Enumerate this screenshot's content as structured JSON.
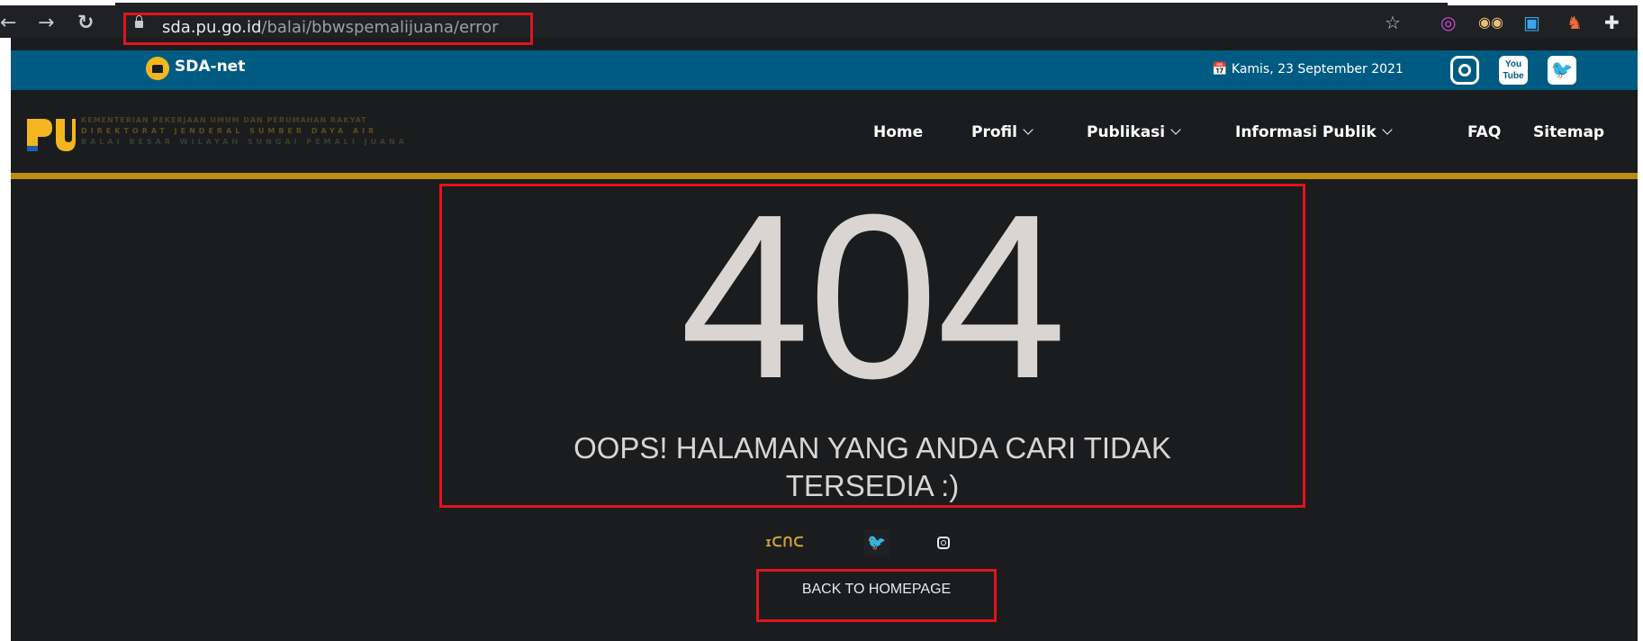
{
  "browser": {
    "url_host": "sda.pu.go.id",
    "url_path": "/balai/bbwspemalijuana/error",
    "back_icon": "back-arrow-icon",
    "forward_icon": "forward-arrow-icon",
    "reload_icon": "reload-icon",
    "bookmark_icon": "star-icon",
    "extension_icons": [
      "opera-icon",
      "spy-icon",
      "translate-icon",
      "person-icon",
      "puzzle-icon"
    ]
  },
  "topbar": {
    "brand": "SDA-net",
    "date": "📅 Kamis, 23 September 2021",
    "social_icons": [
      "instagram-icon",
      "youtube-icon",
      "twitter-icon"
    ],
    "youtube_label": "You\nTube"
  },
  "header": {
    "logo_line1": "KEMENTERIAN PEKERJAAN UMUM DAN PERUMAHAN RAKYAT",
    "logo_line2": "DIREKTORAT JENDERAL SUMBER DAYA AIR",
    "logo_line3": "BALAI BESAR WILAYAH SUNGAI PEMALI JUANA",
    "nav": [
      {
        "label": "Home",
        "dropdown": false
      },
      {
        "label": "Profil",
        "dropdown": true
      },
      {
        "label": "Publikasi",
        "dropdown": true
      },
      {
        "label": "Informasi Publik",
        "dropdown": true
      },
      {
        "label": "FAQ",
        "dropdown": false
      },
      {
        "label": "Sitemap",
        "dropdown": false
      }
    ]
  },
  "error": {
    "code": "404",
    "message": "OOPS! HALAMAN YANG ANDA CARI TIDAK TERSEDIA :)",
    "back_label": "BACK TO HOMEPAGE"
  },
  "colors": {
    "topbar": "#005b82",
    "gold": "#b98e14",
    "highlight": "#e0141e",
    "background": "#1b1c1e"
  }
}
